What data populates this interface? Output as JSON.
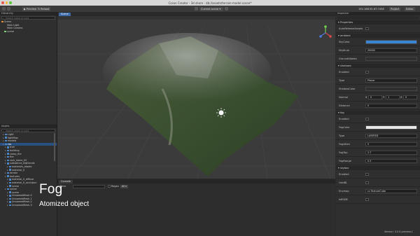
{
  "window": {
    "title": "Cocos Creator - 3d shore - db://assets/terrain-model.scene*"
  },
  "toolbar": {
    "play_label": "Preview",
    "reload_label": "Reload",
    "scene_select": "Current scene",
    "ip": "192.168.55.67:7456",
    "project_btn": "Project",
    "editor_btn": "Editor"
  },
  "hierarchy": {
    "title": "Hierarchy",
    "search_placeholder": "Search name or uuid",
    "items": [
      {
        "label": "Scene",
        "depth": 0,
        "icon": "scene-icon"
      },
      {
        "label": "Main Light",
        "depth": 1,
        "icon": ""
      },
      {
        "label": "Main Camera",
        "depth": 1,
        "icon": ""
      },
      {
        "label": "scene",
        "depth": 1,
        "icon": "node-icon"
      }
    ]
  },
  "assets": {
    "title": "Assets",
    "search_placeholder": "Search name or uuid",
    "items": [
      {
        "label": "Light",
        "depth": 1,
        "selected": false
      },
      {
        "label": "lightMap",
        "depth": 1,
        "selected": false
      },
      {
        "label": "models",
        "depth": 1,
        "selected": false
      },
      {
        "label": "res",
        "depth": 1,
        "selected": true
      },
      {
        "label": "tree",
        "depth": 2,
        "selected": false
      },
      {
        "label": "building",
        "depth": 2,
        "selected": false
      },
      {
        "label": "camp_fire",
        "depth": 2,
        "selected": false
      },
      {
        "label": "fire",
        "depth": 2,
        "selected": false
      },
      {
        "label": "rock_stone_02",
        "depth": 2,
        "selected": false
      },
      {
        "label": "substance_highlands",
        "depth": 2,
        "selected": false
      },
      {
        "label": "materials_assets",
        "depth": 3,
        "selected": false
      },
      {
        "label": "material_0",
        "depth": 3,
        "selected": false
      },
      {
        "label": "terrain",
        "depth": 2,
        "selected": false
      },
      {
        "label": "textures",
        "depth": 2,
        "selected": false
      },
      {
        "label": "material_0_diffuse",
        "depth": 3,
        "selected": false
      },
      {
        "label": "material_0_occlusion",
        "depth": 3,
        "selected": false
      },
      {
        "label": "scene",
        "depth": 3,
        "selected": false
      },
      {
        "label": "scene",
        "depth": 2,
        "selected": false
      },
      {
        "label": "scene",
        "depth": 3,
        "selected": false
      },
      {
        "label": "UnnamedMesh-0",
        "depth": 3,
        "selected": false
      },
      {
        "label": "UnnamedMesh-1",
        "depth": 3,
        "selected": false
      },
      {
        "label": "UnnamedMesh-2",
        "depth": 3,
        "selected": false
      },
      {
        "label": "UnnamedMesh-3",
        "depth": 3,
        "selected": false
      }
    ]
  },
  "scene_view": {
    "tab": "Scene"
  },
  "console": {
    "tab": "Console",
    "clear_label": "Clear",
    "regex_label": "Regex",
    "filter": "All"
  },
  "inspector": {
    "title": "Inspector",
    "rows": [
      {
        "type": "section",
        "label": "Properties"
      },
      {
        "type": "check",
        "label": "AutoReleaseAssets"
      },
      {
        "type": "section",
        "label": "ambient"
      },
      {
        "type": "color",
        "label": "SkyColor",
        "color": "#3a86d4"
      },
      {
        "type": "field",
        "label": "SkyIllum",
        "value": "20000"
      },
      {
        "type": "color",
        "label": "GroundAlbedo",
        "color": "#2f2f2f"
      },
      {
        "type": "section",
        "label": "shadows"
      },
      {
        "type": "check",
        "label": "Enabled"
      },
      {
        "type": "field",
        "label": "Type",
        "value": "Planar"
      },
      {
        "type": "color",
        "label": "ShadowColor",
        "color": "#2f2f2f"
      },
      {
        "type": "vec3",
        "label": "Normal",
        "x": "0",
        "y": "1",
        "z": "0"
      },
      {
        "type": "field",
        "label": "Distance",
        "value": "0"
      },
      {
        "type": "section",
        "label": "fog"
      },
      {
        "type": "check",
        "label": "Enabled"
      },
      {
        "type": "color",
        "label": "FogColor",
        "color": "#e8e8e8"
      },
      {
        "type": "field",
        "label": "Type",
        "value": "LAYERED"
      },
      {
        "type": "field",
        "label": "FogAtten",
        "value": "5"
      },
      {
        "type": "field",
        "label": "FogTop",
        "value": "2.7"
      },
      {
        "type": "field",
        "label": "FogRange",
        "value": "0.5"
      },
      {
        "type": "section",
        "label": "skybox"
      },
      {
        "type": "check",
        "label": "Enabled"
      },
      {
        "type": "check",
        "label": "UseIBL"
      },
      {
        "type": "field",
        "label": "Envmap",
        "value": "cc.TextureCube"
      },
      {
        "type": "check",
        "label": "IsRGBE"
      }
    ]
  },
  "overlay": {
    "title": "Fog",
    "subtitle": "Atomized object"
  },
  "status": {
    "version": "Version: 3.0.0-preview.1"
  }
}
